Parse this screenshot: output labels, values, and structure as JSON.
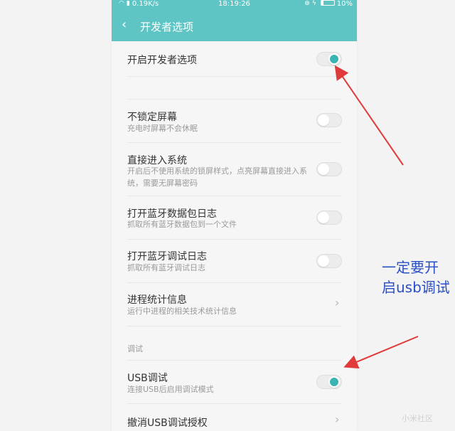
{
  "status_bar": {
    "net_speed": "0.19K/s",
    "time": "18:19:26",
    "battery": "10%"
  },
  "header": {
    "back_icon": "chevron-left-icon",
    "title": "开发者选项"
  },
  "rows": [
    {
      "label": "开启开发者选项",
      "sub": "",
      "toggle": true
    },
    {
      "label": "不锁定屏幕",
      "sub": "充电时屏幕不会休眠",
      "toggle": false
    },
    {
      "label": "直接进入系统",
      "sub": "开启后不使用系统的锁屏样式，点亮屏幕直接进入系统，需要无屏幕密码",
      "toggle": false
    },
    {
      "label": "打开蓝牙数据包日志",
      "sub": "抓取所有蓝牙数据包到一个文件",
      "toggle": false
    },
    {
      "label": "打开蓝牙调试日志",
      "sub": "抓取所有蓝牙调试日志",
      "toggle": false
    },
    {
      "label": "进程统计信息",
      "sub": "运行中进程的相关技术统计信息"
    },
    {
      "label": "USB调试",
      "sub": "连接USB后启用调试模式",
      "toggle": true
    },
    {
      "label": "撤消USB调试授权",
      "sub": ""
    }
  ],
  "section_debug": "调试",
  "annotation": {
    "line1": "一定要开",
    "line2": "启usb调试",
    "color": "#2a4fc4"
  },
  "arrow_color": "#e03a3a",
  "accent_color": "#5fc4c4",
  "watermark": "小米社区"
}
